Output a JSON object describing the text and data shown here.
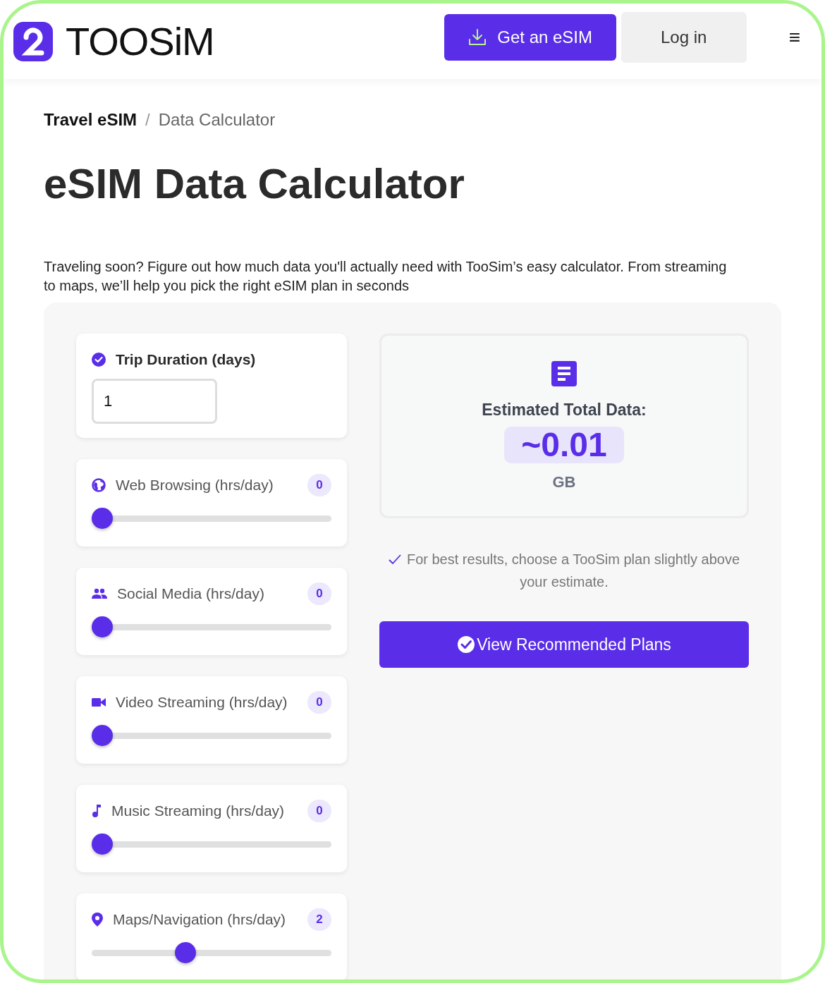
{
  "header": {
    "logo_text": "TOOSiM",
    "get_esim_button": "Get an eSIM",
    "login_button": "Log in",
    "menu_icon": "≡"
  },
  "breadcrumb": [
    {
      "label": "Travel eSIM",
      "current": false
    },
    {
      "label": "Data Calculator",
      "current": true
    }
  ],
  "breadcrumb_separator": "/",
  "title": "eSIM Data Calculator",
  "intro": "Traveling soon? Figure out how much data you'll actually need with TooSim’s easy calculator. From streaming to maps, we’ll help you pick the right eSIM plan in seconds",
  "trip": {
    "label": "Trip Duration (days)",
    "value": "1"
  },
  "sliders": [
    {
      "kind": "web",
      "label": "Web Browsing (hrs/day)",
      "value": "0",
      "level": 0
    },
    {
      "kind": "social",
      "label": "Social Media (hrs/day)",
      "value": "0",
      "level": 0
    },
    {
      "kind": "video",
      "label": "Video Streaming (hrs/day)",
      "value": "0",
      "level": 0
    },
    {
      "kind": "music",
      "label": "Music Streaming (hrs/day)",
      "value": "0",
      "level": 0
    },
    {
      "kind": "maps",
      "label": "Maps/Navigation (hrs/day)",
      "value": "2",
      "level": 0.38
    }
  ],
  "result": {
    "label": "Estimated Total Data:",
    "value": "~0.01",
    "unit": "GB"
  },
  "tip": "For best results, choose a TooSim plan slightly above your estimate.",
  "plans_button": "View Recommended Plans"
}
